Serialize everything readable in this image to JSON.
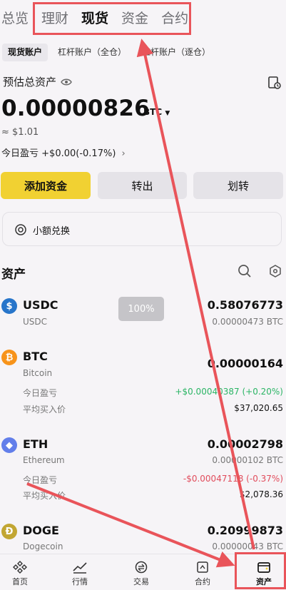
{
  "top_tabs": [
    "总览",
    "理财",
    "现货",
    "资金",
    "合约"
  ],
  "account_tabs": [
    "现货账户",
    "杠杆账户（全仓）",
    "杠杆账户（逐仓）"
  ],
  "summary": {
    "label": "预估总资产",
    "amount": "0.00000826",
    "unit": "BTC",
    "approx": "≈ $1.01",
    "pnl_label": "今日盈亏",
    "pnl_value": "+$0.00(-0.17%)",
    "pnl_chevron": "›"
  },
  "actions": {
    "add": "添加资金",
    "out": "转出",
    "transfer": "划转"
  },
  "small_exchange": "小额兑换",
  "assets_title": "资产",
  "badge": "100%",
  "coins": [
    {
      "symbol": "USDC",
      "name": "USDC",
      "amount": "0.58076773",
      "btc": "0.00000473 BTC",
      "color": "#2775ca",
      "icon": "$"
    },
    {
      "symbol": "BTC",
      "name": "Bitcoin",
      "amount": "0.00000164",
      "btc": "",
      "pnl_label": "今日盈亏",
      "pnl": "+$0.00040387 (+0.20%)",
      "avg_label": "平均买入价",
      "avg": "$37,020.65",
      "color": "#f7931a",
      "icon": "₿"
    },
    {
      "symbol": "ETH",
      "name": "Ethereum",
      "amount": "0.00002798",
      "btc": "0.00000102 BTC",
      "pnl_label": "今日盈亏",
      "pnl": "-$0.00047118 (-0.37%)",
      "avg_label": "平均买入价",
      "avg": "$2,078.36",
      "color": "#627eea",
      "icon": "◆"
    },
    {
      "symbol": "DOGE",
      "name": "Dogecoin",
      "amount": "0.20999873",
      "btc": "0.00000043 BTC",
      "color": "#c2a633",
      "icon": "Ð"
    }
  ],
  "nav": [
    "首页",
    "行情",
    "交易",
    "合约",
    "资产"
  ],
  "annotation_colors": {
    "highlight": "#e9545a"
  }
}
